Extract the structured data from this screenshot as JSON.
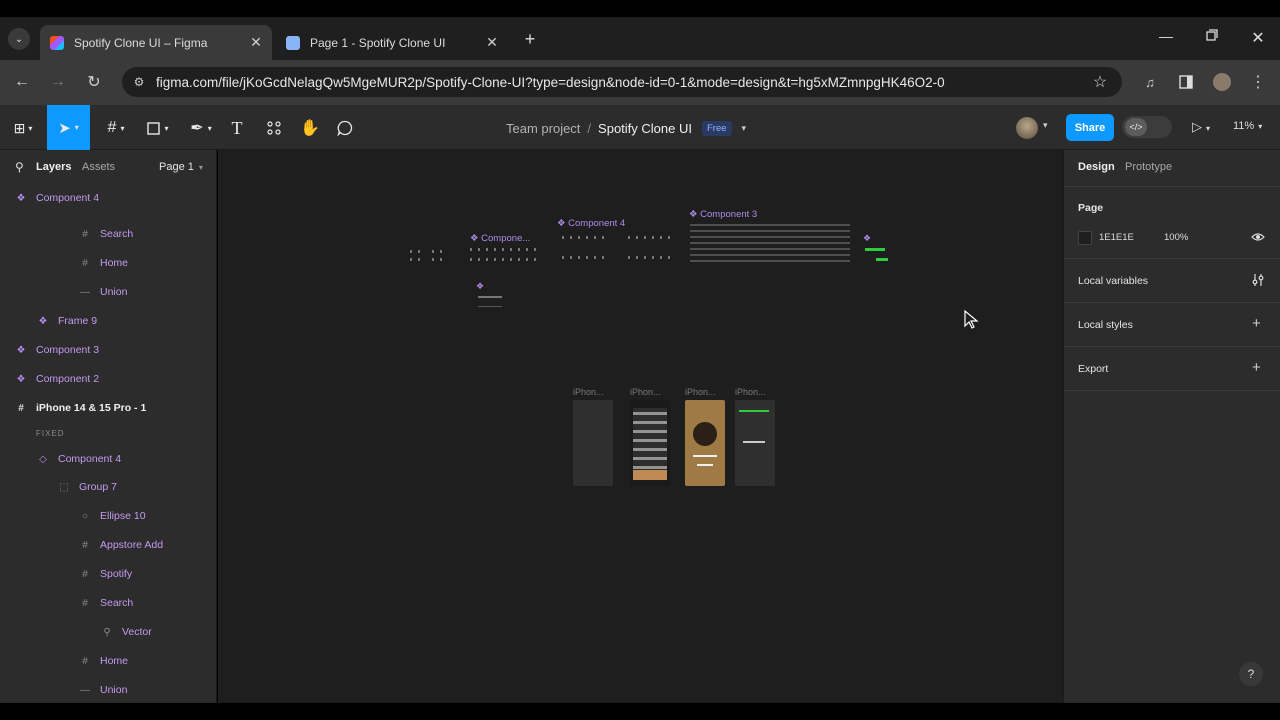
{
  "browser": {
    "tabs": [
      {
        "label": "Spotify Clone UI – Figma",
        "active": true
      },
      {
        "label": "Page 1 - Spotify Clone UI",
        "active": false
      }
    ],
    "url": "figma.com/file/jKoGcdNelagQw5MgeMUR2p/Spotify-Clone-UI?type=design&node-id=0-1&mode=design&t=hg5xMZmnpgHK46O2-0"
  },
  "toolbar": {
    "breadcrumb_project": "Team project",
    "breadcrumb_sep": "/",
    "file_name": "Spotify Clone UI",
    "plan_badge": "Free",
    "share_label": "Share",
    "zoom": "11%"
  },
  "left_panel": {
    "tabs": {
      "layers": "Layers",
      "assets": "Assets"
    },
    "page_selector": "Page 1",
    "layers": [
      {
        "label": "Component 4",
        "icon": "component-icon"
      },
      {
        "label": "Search",
        "icon": "frame-icon"
      },
      {
        "label": "Home",
        "icon": "frame-icon"
      },
      {
        "label": "Union",
        "icon": "line-icon"
      },
      {
        "label": "Frame 9",
        "icon": "component-icon"
      },
      {
        "label": "Component 3",
        "icon": "component-icon"
      },
      {
        "label": "Component 2",
        "icon": "component-icon"
      },
      {
        "label": "iPhone 14 & 15 Pro - 1",
        "icon": "frame-icon"
      },
      {
        "label": "FIXED",
        "icon": ""
      },
      {
        "label": "Component 4",
        "icon": "instance-icon"
      },
      {
        "label": "Group 7",
        "icon": "group-icon"
      },
      {
        "label": "Ellipse 10",
        "icon": "ellipse-icon"
      },
      {
        "label": "Appstore Add",
        "icon": "frame-icon"
      },
      {
        "label": "Spotify",
        "icon": "frame-icon"
      },
      {
        "label": "Search",
        "icon": "frame-icon"
      },
      {
        "label": "Vector",
        "icon": "search-icon"
      },
      {
        "label": "Home",
        "icon": "frame-icon"
      },
      {
        "label": "Union",
        "icon": "line-icon"
      }
    ]
  },
  "right_panel": {
    "tabs": {
      "design": "Design",
      "prototype": "Prototype"
    },
    "page_heading": "Page",
    "page_color_hex": "1E1E1E",
    "page_opacity": "100%",
    "local_variables": "Local variables",
    "local_styles": "Local styles",
    "export": "Export"
  },
  "canvas": {
    "labels": {
      "component_truncated": "Compone...",
      "component4": "Component 4",
      "component3": "Component 3",
      "iphone1": "iPhon...",
      "iphone2": "iPhon...",
      "iphone3": "iPhon...",
      "iphone4": "iPhon..."
    }
  },
  "help_label": "?",
  "colors": {
    "accent_blue": "#0d99ff",
    "component_purple": "#9747ff",
    "canvas_bg": "#1e1e1e",
    "panel_bg": "#2c2c2c"
  }
}
